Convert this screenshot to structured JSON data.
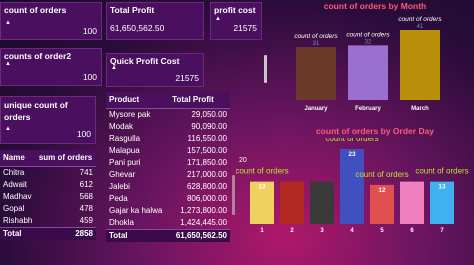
{
  "cards": {
    "count_of_orders": {
      "label": "count of orders",
      "value": "100"
    },
    "count_of_order2": {
      "label": "counts of order2",
      "value": "100"
    },
    "unique_count": {
      "label": "unique count of orders",
      "value": "100"
    },
    "total_profit": {
      "label": "Total Profit",
      "value": "61,650,562.50"
    },
    "profit_cost": {
      "label": "profit cost",
      "value": "21575"
    },
    "quick_profit_cost": {
      "label": "Quick Profit Cost",
      "value": "21575"
    }
  },
  "name_table": {
    "headers": [
      "Name",
      "sum of orders"
    ],
    "rows": [
      [
        "Chitra",
        "741"
      ],
      [
        "Adwait",
        "612"
      ],
      [
        "Madhav",
        "568"
      ],
      [
        "Gopal",
        "478"
      ],
      [
        "Rishabh",
        "459"
      ]
    ],
    "total": [
      "Total",
      "2858"
    ]
  },
  "product_table": {
    "headers": [
      "Product",
      "Total Profit"
    ],
    "rows": [
      [
        "Mysore pak",
        "29,050.00"
      ],
      [
        "Modak",
        "90,090.00"
      ],
      [
        "Rasgulla",
        "116,550.00"
      ],
      [
        "Malapua",
        "157,500.00"
      ],
      [
        "Pani puri",
        "171,850.00"
      ],
      [
        "Ghevar",
        "217,000.00"
      ],
      [
        "Jalebi",
        "628,800.00"
      ],
      [
        "Peda",
        "806,000.00"
      ],
      [
        "Gajar ka halwa",
        "1,273,800.00"
      ],
      [
        "Dhokla",
        "1,424,445.00"
      ]
    ],
    "total": [
      "Total",
      "61,650,562.50"
    ]
  },
  "chart_data": [
    {
      "type": "bar",
      "title": "count of orders by Month",
      "categories": [
        "January",
        "February",
        "March"
      ],
      "series": [
        {
          "name": "count of orders",
          "values": [
            31,
            32,
            41
          ]
        }
      ],
      "colors": [
        "#6b3a2a",
        "#9b6fd0",
        "#b8900a"
      ],
      "data_label_name": "count of orders",
      "ylim": [
        0,
        41
      ]
    },
    {
      "type": "bar",
      "title": "count of orders by Order Day",
      "categories": [
        "1",
        "2",
        "3",
        "4",
        "5",
        "6",
        "7"
      ],
      "series": [
        {
          "name": "count of orders",
          "values": [
            13,
            13,
            13,
            23,
            12,
            13,
            13
          ]
        }
      ],
      "colors": [
        "#f0d060",
        "#b02820",
        "#3a3a3a",
        "#4050c0",
        "#e05050",
        "#f080c0",
        "#40b0f0"
      ],
      "data_labels": [
        {
          "index": 0,
          "text": "13",
          "name": "count of orders"
        },
        {
          "index": 3,
          "text": "23",
          "name": "count of orders"
        },
        {
          "index": 4,
          "text": "12",
          "name": "count of orders"
        },
        {
          "index": 6,
          "text": "13",
          "name": "count of orders"
        }
      ],
      "y_axis_tick": "20",
      "ylim": [
        0,
        23
      ]
    }
  ]
}
